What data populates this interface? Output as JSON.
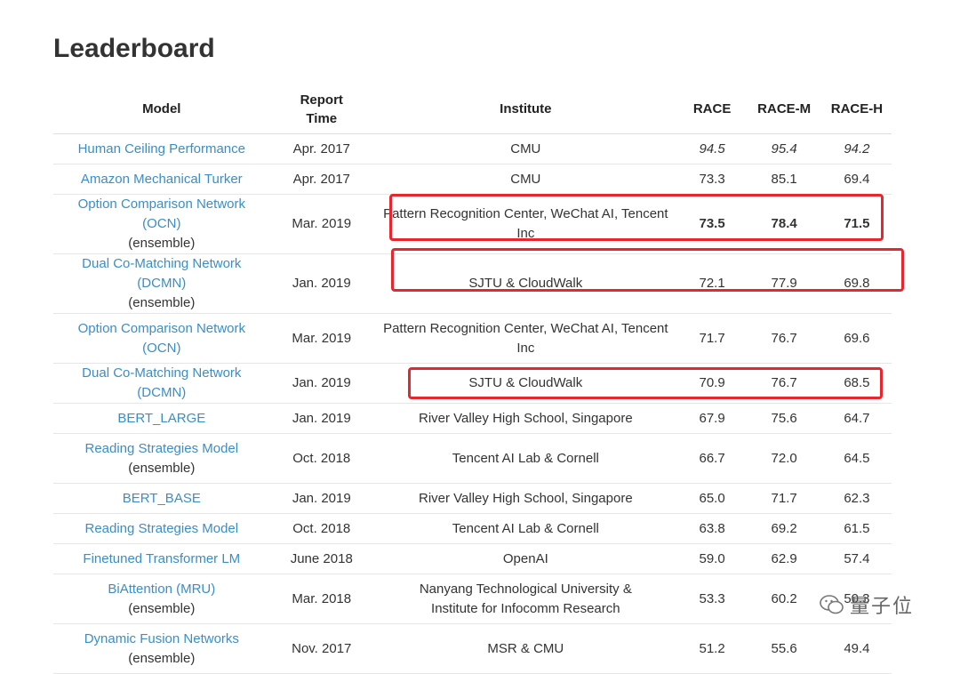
{
  "page": {
    "title": "Leaderboard"
  },
  "columns": {
    "model": "Model",
    "report_time_line1": "Report",
    "report_time_line2": "Time",
    "institute": "Institute",
    "race": "RACE",
    "race_m": "RACE-M",
    "race_h": "RACE-H"
  },
  "rows": [
    {
      "model": "Human Ceiling Performance",
      "note": "",
      "time": "Apr. 2017",
      "institute_line1": "CMU",
      "institute_line2": "",
      "race": "94.5",
      "race_m": "95.4",
      "race_h": "94.2",
      "style": "italic",
      "h": 34
    },
    {
      "model": "Amazon Mechanical Turker",
      "note": "",
      "time": "Apr. 2017",
      "institute_line1": "CMU",
      "institute_line2": "",
      "race": "73.3",
      "race_m": "85.1",
      "race_h": "69.4",
      "style": "",
      "h": 34
    },
    {
      "model": "Option Comparison Network (OCN)",
      "note": "(ensemble)",
      "time": "Mar. 2019",
      "institute_line1": "Pattern Recognition Center, WeChat AI, Tencent",
      "institute_line2": "Inc",
      "race": "73.5",
      "race_m": "78.4",
      "race_h": "71.5",
      "style": "bold",
      "h": 56
    },
    {
      "model": "Dual Co-Matching Network (DCMN)",
      "note": "(ensemble)",
      "time": "Jan. 2019",
      "institute_line1": "SJTU & CloudWalk",
      "institute_line2": "",
      "race": "72.1",
      "race_m": "77.9",
      "race_h": "69.8",
      "style": "",
      "h": 56
    },
    {
      "model": "Option Comparison Network (OCN)",
      "note": "",
      "time": "Mar. 2019",
      "institute_line1": "Pattern Recognition Center, WeChat AI, Tencent",
      "institute_line2": "Inc",
      "race": "71.7",
      "race_m": "76.7",
      "race_h": "69.6",
      "style": "",
      "h": 56
    },
    {
      "model": "Dual Co-Matching Network (DCMN)",
      "note": "",
      "time": "Jan. 2019",
      "institute_line1": "SJTU & CloudWalk",
      "institute_line2": "",
      "race": "70.9",
      "race_m": "76.7",
      "race_h": "68.5",
      "style": "",
      "h": 34
    },
    {
      "model": "BERT_LARGE",
      "note": "",
      "time": "Jan. 2019",
      "institute_line1": "River Valley High School, Singapore",
      "institute_line2": "",
      "race": "67.9",
      "race_m": "75.6",
      "race_h": "64.7",
      "style": "",
      "h": 34
    },
    {
      "model": "Reading Strategies Model",
      "note": "(ensemble)",
      "time": "Oct. 2018",
      "institute_line1": "Tencent AI Lab & Cornell",
      "institute_line2": "",
      "race": "66.7",
      "race_m": "72.0",
      "race_h": "64.5",
      "style": "",
      "h": 56
    },
    {
      "model": "BERT_BASE",
      "note": "",
      "time": "Jan. 2019",
      "institute_line1": "River Valley High School, Singapore",
      "institute_line2": "",
      "race": "65.0",
      "race_m": "71.7",
      "race_h": "62.3",
      "style": "",
      "h": 34
    },
    {
      "model": "Reading Strategies Model",
      "note": "",
      "time": "Oct. 2018",
      "institute_line1": "Tencent AI Lab & Cornell",
      "institute_line2": "",
      "race": "63.8",
      "race_m": "69.2",
      "race_h": "61.5",
      "style": "",
      "h": 34
    },
    {
      "model": "Finetuned Transformer LM",
      "note": "",
      "time": "June 2018",
      "institute_line1": "OpenAI",
      "institute_line2": "",
      "race": "59.0",
      "race_m": "62.9",
      "race_h": "57.4",
      "style": "",
      "h": 34
    },
    {
      "model": "BiAttention (MRU)",
      "note": "(ensemble)",
      "time": "Mar. 2018",
      "institute_line1": "Nanyang Technological University &",
      "institute_line2": "Institute for Infocomm Research",
      "race": "53.3",
      "race_m": "60.2",
      "race_h": "50.3",
      "style": "",
      "h": 56
    },
    {
      "model": "Dynamic Fusion Networks",
      "note": "(ensemble)",
      "time": "Nov. 2017",
      "institute_line1": "MSR & CMU",
      "institute_line2": "",
      "race": "51.2",
      "race_m": "55.6",
      "race_h": "49.4",
      "style": "",
      "h": 56
    }
  ],
  "watermark": {
    "text": "量子位",
    "icon": "wechat-icon"
  },
  "colors": {
    "link": "#3a8ec6",
    "highlight": "#e8262d"
  }
}
